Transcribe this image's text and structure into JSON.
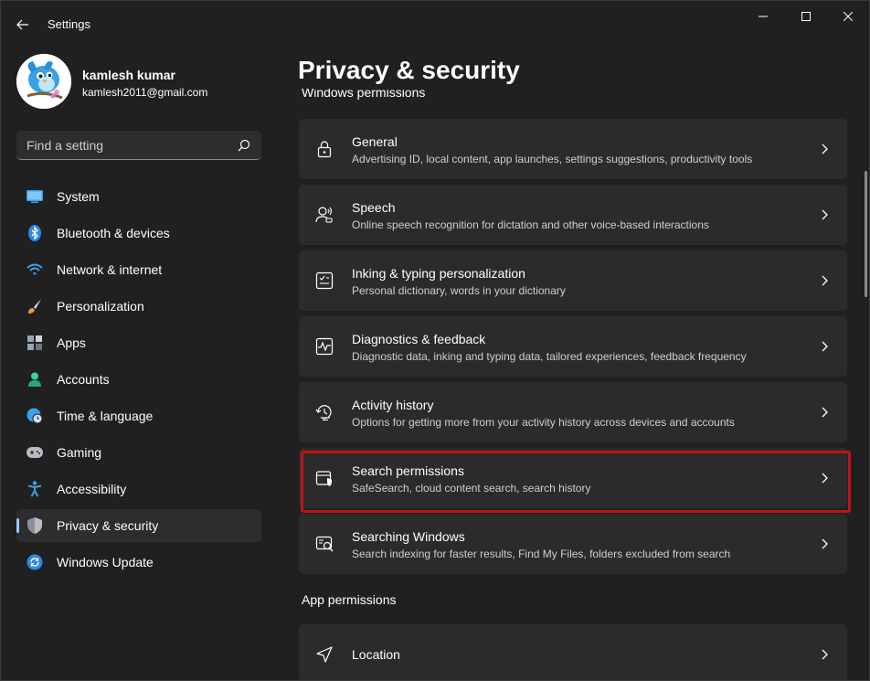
{
  "window": {
    "title": "Settings"
  },
  "profile": {
    "name": "kamlesh kumar",
    "email": "kamlesh2011@gmail.com"
  },
  "search": {
    "placeholder": "Find a setting"
  },
  "nav": {
    "items": [
      {
        "label": "System",
        "icon": "monitor-icon"
      },
      {
        "label": "Bluetooth & devices",
        "icon": "bluetooth-icon"
      },
      {
        "label": "Network & internet",
        "icon": "wifi-icon"
      },
      {
        "label": "Personalization",
        "icon": "brush-icon"
      },
      {
        "label": "Apps",
        "icon": "apps-icon"
      },
      {
        "label": "Accounts",
        "icon": "person-icon"
      },
      {
        "label": "Time & language",
        "icon": "globe-clock-icon"
      },
      {
        "label": "Gaming",
        "icon": "gamepad-icon"
      },
      {
        "label": "Accessibility",
        "icon": "accessibility-icon"
      },
      {
        "label": "Privacy & security",
        "icon": "shield-icon",
        "active": true
      },
      {
        "label": "Windows Update",
        "icon": "update-icon"
      }
    ]
  },
  "main": {
    "title": "Privacy & security",
    "cut_section_label": "Windows permissions",
    "cards": [
      {
        "title": "General",
        "subtitle": "Advertising ID, local content, app launches, settings suggestions, productivity tools",
        "icon": "lock-icon"
      },
      {
        "title": "Speech",
        "subtitle": "Online speech recognition for dictation and other voice-based interactions",
        "icon": "speech-icon"
      },
      {
        "title": "Inking & typing personalization",
        "subtitle": "Personal dictionary, words in your dictionary",
        "icon": "inking-icon"
      },
      {
        "title": "Diagnostics & feedback",
        "subtitle": "Diagnostic data, inking and typing data, tailored experiences, feedback frequency",
        "icon": "diagnostics-icon"
      },
      {
        "title": "Activity history",
        "subtitle": "Options for getting more from your activity history across devices and accounts",
        "icon": "history-icon"
      },
      {
        "title": "Search permissions",
        "subtitle": "SafeSearch, cloud content search, search history",
        "icon": "search-permissions-icon",
        "highlighted": true
      },
      {
        "title": "Searching Windows",
        "subtitle": "Search indexing for faster results, Find My Files, folders excluded from search",
        "icon": "searching-windows-icon"
      }
    ],
    "app_permissions_label": "App permissions",
    "app_cards": [
      {
        "title": "Location",
        "icon": "location-icon"
      }
    ]
  },
  "colors": {
    "background": "#202020",
    "card": "#2b2b2b",
    "accent": "#9ec6f3",
    "highlight": "#c0141c"
  }
}
